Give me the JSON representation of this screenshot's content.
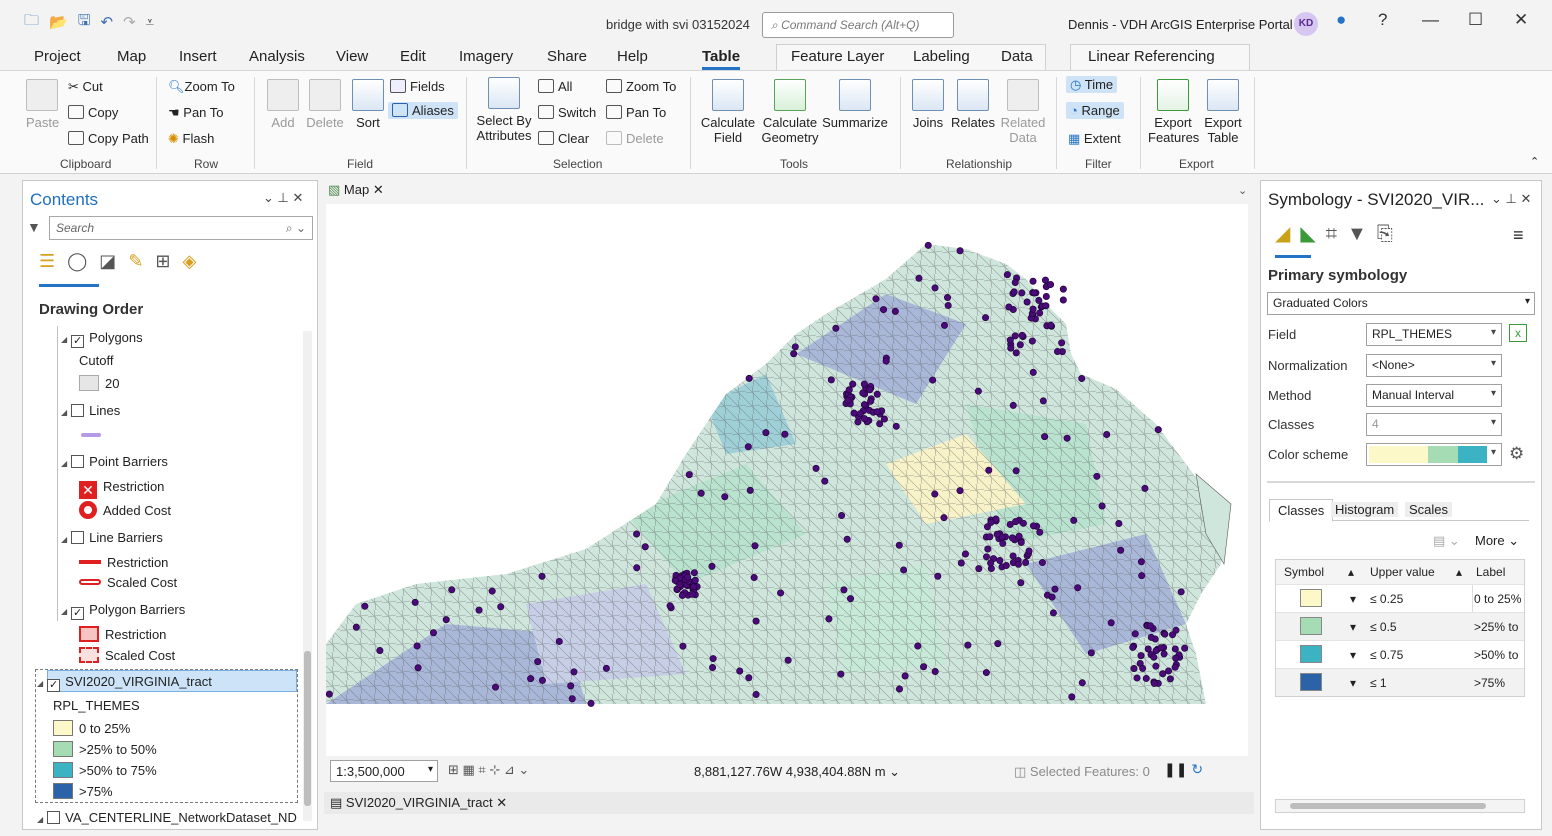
{
  "window": {
    "title": "bridge with svi 03152024",
    "command_search_placeholder": "Command Search (Alt+Q)",
    "user": "Dennis - VDH ArcGIS Enterprise Portal",
    "avatar": "KD"
  },
  "tabs": [
    "Project",
    "Map",
    "Insert",
    "Analysis",
    "View",
    "Edit",
    "Imagery",
    "Share",
    "Help",
    "Table",
    "Feature Layer",
    "Labeling",
    "Data",
    "Linear Referencing"
  ],
  "ribbon": {
    "clipboard": {
      "paste": "Paste",
      "cut": "Cut",
      "copy": "Copy",
      "copy_path": "Copy Path",
      "label": "Clipboard"
    },
    "row": {
      "zoom_to": "Zoom To",
      "pan_to": "Pan To",
      "flash": "Flash",
      "label": "Row"
    },
    "field": {
      "add": "Add",
      "delete": "Delete",
      "sort": "Sort",
      "fields": "Fields",
      "aliases": "Aliases",
      "label": "Field"
    },
    "selection": {
      "select_by_attributes_1": "Select By",
      "select_by_attributes_2": "Attributes",
      "all": "All",
      "switch": "Switch",
      "clear": "Clear",
      "zoom_to": "Zoom To",
      "pan_to": "Pan To",
      "delete": "Delete",
      "label": "Selection"
    },
    "tools": {
      "calc_field_1": "Calculate",
      "calc_field_2": "Field",
      "calc_geom_1": "Calculate",
      "calc_geom_2": "Geometry",
      "summarize": "Summarize",
      "label": "Tools"
    },
    "relationship": {
      "joins": "Joins",
      "relates": "Relates",
      "related_1": "Related",
      "related_2": "Data",
      "label": "Relationship"
    },
    "filter": {
      "time": "Time",
      "range": "Range",
      "extent": "Extent",
      "label": "Filter"
    },
    "export": {
      "features_1": "Export",
      "features_2": "Features",
      "table_1": "Export",
      "table_2": "Table",
      "label": "Export"
    }
  },
  "contents": {
    "title": "Contents",
    "search_placeholder": "Search",
    "drawing_order": "Drawing Order",
    "layers": {
      "polygons": "Polygons",
      "cutoff": "Cutoff",
      "cutoff_value": "20",
      "lines": "Lines",
      "point_barriers": "Point Barriers",
      "restriction": "Restriction",
      "added_cost": "Added Cost",
      "line_barriers": "Line Barriers",
      "line_restriction": "Restriction",
      "scaled_cost": "Scaled Cost",
      "polygon_barriers": "Polygon Barriers",
      "poly_restriction": "Restriction",
      "poly_scaled_cost": "Scaled Cost",
      "svi_layer": "SVI2020_VIRGINIA_tract",
      "field": "RPL_THEMES",
      "legend": [
        "0 to 25%",
        ">25% to 50%",
        ">50% to 75%",
        ">75%"
      ],
      "network": "VA_CENTERLINE_NetworkDataset_ND"
    }
  },
  "map": {
    "tab": "Map",
    "scale": "1:3,500,000",
    "coords": "8,881,127.76W 4,938,404.88N m",
    "selected": "Selected Features: 0",
    "table_tab": "SVI2020_VIRGINIA_tract"
  },
  "symbology": {
    "title": "Symbology - SVI2020_VIR...",
    "primary": "Primary symbology",
    "renderer": "Graduated Colors",
    "field_label": "Field",
    "field": "RPL_THEMES",
    "normalization_label": "Normalization",
    "normalization": "<None>",
    "method_label": "Method",
    "method": "Manual Interval",
    "classes_label": "Classes",
    "classes": "4",
    "scheme_label": "Color scheme",
    "subtabs": [
      "Classes",
      "Histogram",
      "Scales"
    ],
    "more": "More",
    "headers": {
      "symbol": "Symbol",
      "upper": "Upper value",
      "label": "Label"
    },
    "rows": [
      {
        "upper": "≤  0.25",
        "label": "0 to 25%",
        "color": "#fdf8c8"
      },
      {
        "upper": "≤  0.5",
        "label": ">25% to",
        "color": "#a6dcb4"
      },
      {
        "upper": "≤  0.75",
        "label": ">50% to",
        "color": "#3cb3c2"
      },
      {
        "upper": "≤  1",
        "label": ">75%",
        "color": "#2c62a8"
      }
    ]
  },
  "colors": {
    "accent": "#2473c7",
    "q1": "#fdf8c8",
    "q2": "#a6dcb4",
    "q3": "#3cb3c2",
    "q4": "#2c62a8",
    "point": "#4b0a7a"
  }
}
